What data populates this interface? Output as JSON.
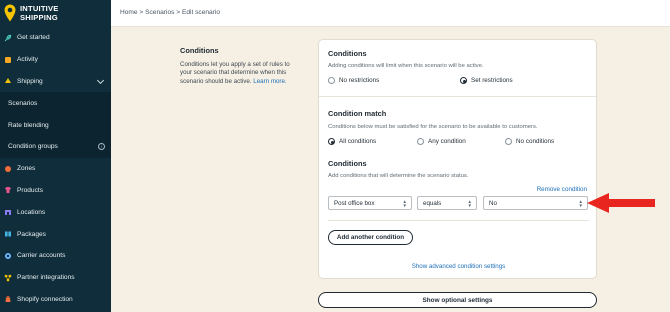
{
  "brand": {
    "line1": "INTUITIVE",
    "line2": "SHIPPING"
  },
  "sidebar": {
    "items": [
      {
        "label": "Get started",
        "icon": "rocket-icon"
      },
      {
        "label": "Activity",
        "icon": "activity-icon"
      },
      {
        "label": "Shipping",
        "icon": "shipping-icon"
      },
      {
        "label": "Scenarios"
      },
      {
        "label": "Rate blending"
      },
      {
        "label": "Condition groups"
      },
      {
        "label": "Zones",
        "icon": "zones-icon"
      },
      {
        "label": "Products",
        "icon": "products-icon"
      },
      {
        "label": "Locations",
        "icon": "locations-icon"
      },
      {
        "label": "Packages",
        "icon": "packages-icon"
      },
      {
        "label": "Carrier accounts",
        "icon": "carrier-icon"
      },
      {
        "label": "Partner integrations",
        "icon": "partner-icon"
      },
      {
        "label": "Shopify connection",
        "icon": "shopify-icon"
      }
    ]
  },
  "breadcrumb": "Home > Scenarios > Edit scenario",
  "description": {
    "title": "Conditions",
    "body": "Conditions let you apply a set of rules to your scenario that determine when this scenario should be active.",
    "link": "Learn more."
  },
  "card": {
    "conditions": {
      "title": "Conditions",
      "subtitle": "Adding conditions will limit when this scenario will be active.",
      "options": [
        "No restrictions",
        "Set restrictions"
      ],
      "selected": "Set restrictions"
    },
    "match": {
      "title": "Condition match",
      "subtitle": "Conditions below must be satisfied for the scenario to be available to customers.",
      "options": [
        "All conditions",
        "Any condition",
        "No conditions"
      ],
      "selected": "All conditions"
    },
    "list": {
      "title": "Conditions",
      "subtitle": "Add conditions that will determine the scenario status.",
      "remove_label": "Remove condition",
      "field": "Post office box",
      "operator": "equals",
      "value": "No",
      "add_label": "Add another condition",
      "advanced_label": "Show advanced condition settings"
    }
  },
  "optional_label": "Show optional settings",
  "colors": {
    "sidebar_bg": "#0f2d3a",
    "page_bg": "#f6f0e4",
    "link": "#1d6fb8",
    "arrow": "#e8261f",
    "logo_yellow": "#f5c400"
  }
}
